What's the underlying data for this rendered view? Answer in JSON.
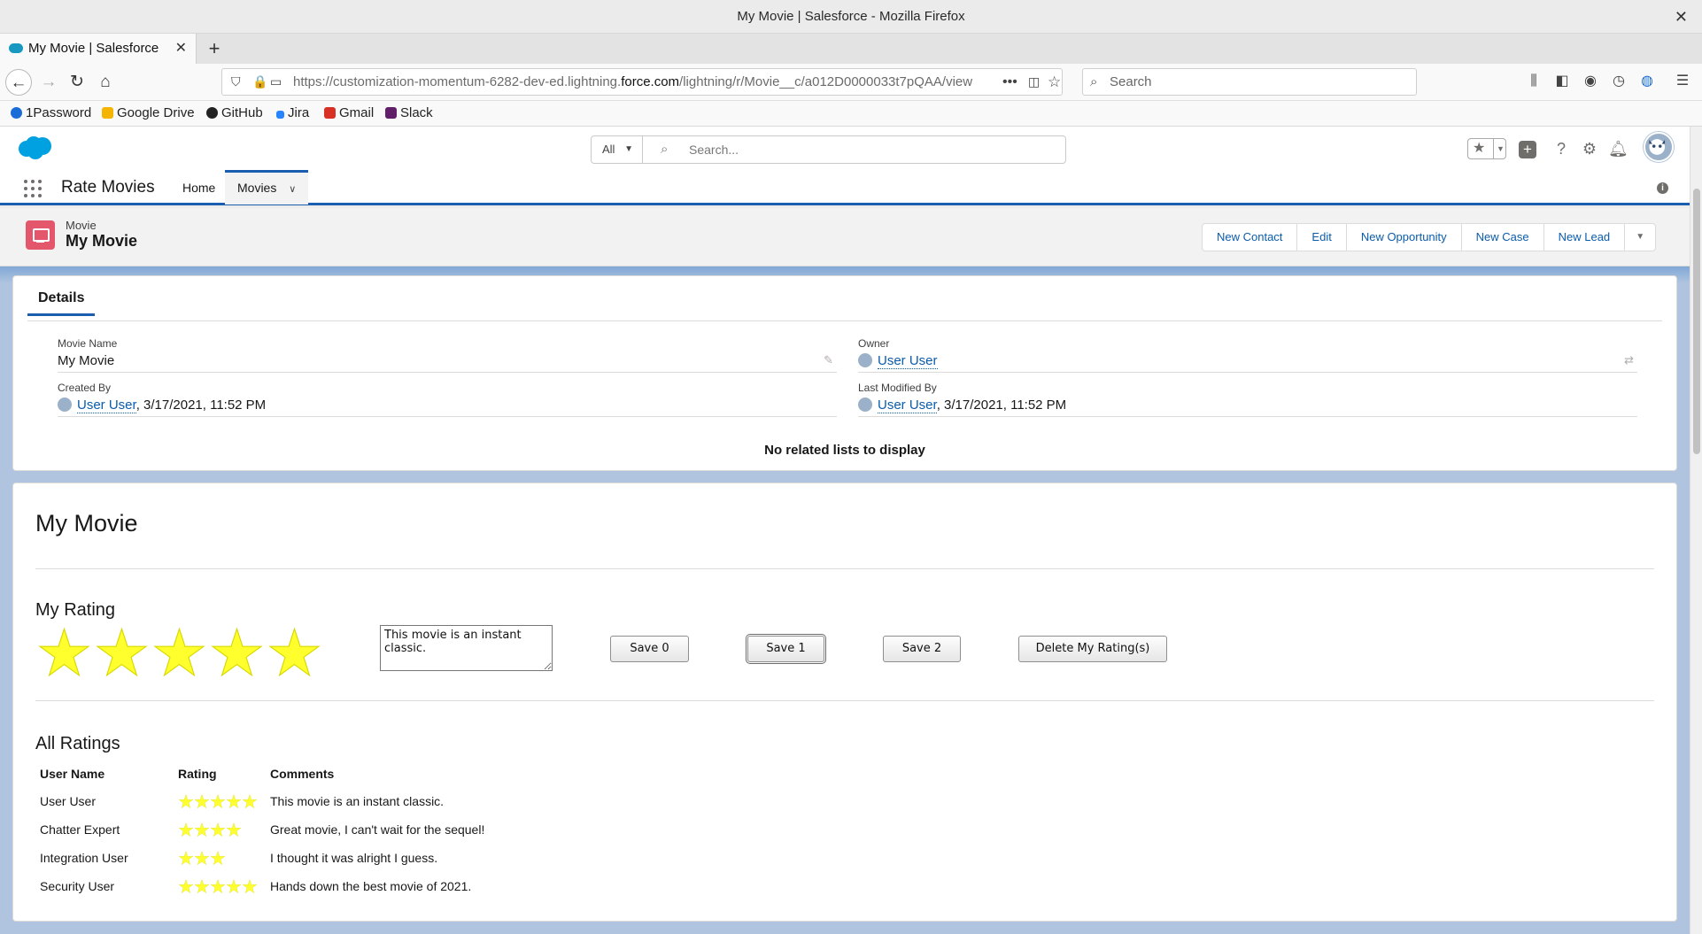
{
  "browser": {
    "window_title": "My Movie | Salesforce - Mozilla Firefox",
    "tab_title": "My Movie | Salesforce",
    "url_prefix": "https://customization-momentum-6282-dev-ed.lightning.",
    "url_domain": "force.com",
    "url_path": "/lightning/r/Movie__c/a012D0000033t7pQAA/view",
    "search_placeholder": "Search",
    "bookmarks": [
      {
        "label": "1Password",
        "color": "#1a6cd6"
      },
      {
        "label": "Google Drive",
        "color": "#f4b400"
      },
      {
        "label": "GitHub",
        "color": "#222222"
      },
      {
        "label": "Jira",
        "color": "#2684ff"
      },
      {
        "label": "Gmail",
        "color": "#d93025"
      },
      {
        "label": "Slack",
        "color": "#611f69"
      }
    ]
  },
  "sf_header": {
    "search_scope": "All",
    "search_placeholder": "Search...",
    "app_name": "Rate Movies",
    "nav_items": [
      "Home",
      "Movies"
    ],
    "active_nav": "Movies"
  },
  "record": {
    "object_type": "Movie",
    "name": "My Movie",
    "actions": [
      "New Contact",
      "Edit",
      "New Opportunity",
      "New Case",
      "New Lead"
    ],
    "details_tab": "Details",
    "fields": {
      "movie_name_label": "Movie Name",
      "movie_name": "My Movie",
      "owner_label": "Owner",
      "owner": "User User",
      "created_by_label": "Created By",
      "created_by_user": "User User",
      "created_by_date": ", 3/17/2021, 11:52 PM",
      "last_modified_label": "Last Modified By",
      "last_modified_user": "User User",
      "last_modified_date": ", 3/17/2021, 11:52 PM"
    },
    "related_empty": "No related lists to display"
  },
  "rating_component": {
    "title": "My Movie",
    "my_rating_heading": "My Rating",
    "my_rating_stars": 5,
    "comment": "This movie is an instant classic.",
    "buttons": [
      "Save 0",
      "Save 1",
      "Save 2",
      "Delete My Rating(s)"
    ],
    "all_ratings_heading": "All Ratings",
    "columns": [
      "User Name",
      "Rating",
      "Comments"
    ],
    "rows": [
      {
        "user": "User User",
        "rating": 5,
        "comment": "This movie is an instant classic."
      },
      {
        "user": "Chatter Expert",
        "rating": 4,
        "comment": "Great movie, I can't wait for the sequel!"
      },
      {
        "user": "Integration User",
        "rating": 3,
        "comment": "I thought it was alright I guess."
      },
      {
        "user": "Security User",
        "rating": 5,
        "comment": "Hands down the best movie of 2021."
      }
    ],
    "star_color": "#ffff2e"
  }
}
